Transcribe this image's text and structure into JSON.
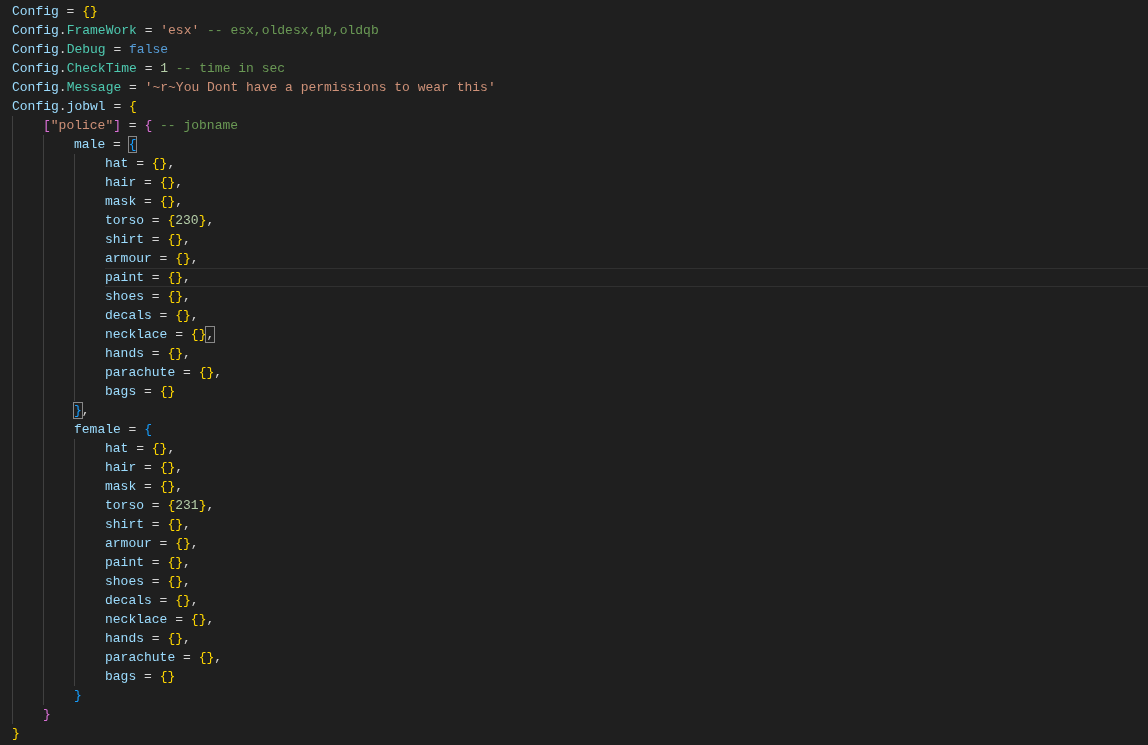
{
  "lines": [
    {
      "tokens": [
        {
          "text": "Config",
          "kind": "var"
        },
        {
          "text": " = ",
          "kind": "op"
        },
        {
          "text": "{}",
          "kind": "brace1"
        }
      ]
    },
    {
      "tokens": [
        {
          "text": "Config",
          "kind": "var"
        },
        {
          "text": ".",
          "kind": "op"
        },
        {
          "text": "FrameWork",
          "kind": "prop"
        },
        {
          "text": " = ",
          "kind": "op"
        },
        {
          "text": "'esx'",
          "kind": "string"
        },
        {
          "text": " -- esx,oldesx,qb,oldqb",
          "kind": "comment"
        }
      ]
    },
    {
      "tokens": [
        {
          "text": "Config",
          "kind": "var"
        },
        {
          "text": ".",
          "kind": "op"
        },
        {
          "text": "Debug",
          "kind": "prop"
        },
        {
          "text": " = ",
          "kind": "op"
        },
        {
          "text": "false",
          "kind": "keyword"
        }
      ]
    },
    {
      "tokens": [
        {
          "text": "Config",
          "kind": "var"
        },
        {
          "text": ".",
          "kind": "op"
        },
        {
          "text": "CheckTime",
          "kind": "prop"
        },
        {
          "text": " = ",
          "kind": "op"
        },
        {
          "text": "1",
          "kind": "number"
        },
        {
          "text": " -- time in sec",
          "kind": "comment"
        }
      ]
    },
    {
      "tokens": [
        {
          "text": "Config",
          "kind": "var"
        },
        {
          "text": ".",
          "kind": "op"
        },
        {
          "text": "Message",
          "kind": "prop"
        },
        {
          "text": " = ",
          "kind": "op"
        },
        {
          "text": "'~r~You Dont have a permissions to wear this'",
          "kind": "string"
        }
      ]
    },
    {
      "tokens": [
        {
          "text": "Config",
          "kind": "var"
        },
        {
          "text": ".",
          "kind": "op"
        },
        {
          "text": "jobwl",
          "kind": "var"
        },
        {
          "text": " = ",
          "kind": "op"
        },
        {
          "text": "{",
          "kind": "brace1"
        }
      ],
      "children": [
        {
          "tokens": [
            {
              "text": "[",
              "kind": "brace2"
            },
            {
              "text": "\"police\"",
              "kind": "string"
            },
            {
              "text": "]",
              "kind": "brace2"
            },
            {
              "text": " = ",
              "kind": "op"
            },
            {
              "text": "{",
              "kind": "brace2"
            },
            {
              "text": " -- jobname",
              "kind": "comment"
            }
          ],
          "children": [
            {
              "tokens": [
                {
                  "text": "male",
                  "kind": "var"
                },
                {
                  "text": " = ",
                  "kind": "op"
                },
                {
                  "text": "{",
                  "kind": "brace3",
                  "boxed": true
                }
              ],
              "children": [
                {
                  "tokens": [
                    {
                      "text": "hat",
                      "kind": "var"
                    },
                    {
                      "text": " = ",
                      "kind": "op"
                    },
                    {
                      "text": "{}",
                      "kind": "brace1"
                    },
                    {
                      "text": ",",
                      "kind": "op"
                    }
                  ]
                },
                {
                  "tokens": [
                    {
                      "text": "hair",
                      "kind": "var"
                    },
                    {
                      "text": " = ",
                      "kind": "op"
                    },
                    {
                      "text": "{}",
                      "kind": "brace1"
                    },
                    {
                      "text": ",",
                      "kind": "op"
                    }
                  ]
                },
                {
                  "tokens": [
                    {
                      "text": "mask",
                      "kind": "var"
                    },
                    {
                      "text": " = ",
                      "kind": "op"
                    },
                    {
                      "text": "{}",
                      "kind": "brace1"
                    },
                    {
                      "text": ",",
                      "kind": "op"
                    }
                  ]
                },
                {
                  "tokens": [
                    {
                      "text": "torso",
                      "kind": "var"
                    },
                    {
                      "text": " = ",
                      "kind": "op"
                    },
                    {
                      "text": "{",
                      "kind": "brace1"
                    },
                    {
                      "text": "230",
                      "kind": "number"
                    },
                    {
                      "text": "}",
                      "kind": "brace1"
                    },
                    {
                      "text": ",",
                      "kind": "op"
                    }
                  ]
                },
                {
                  "tokens": [
                    {
                      "text": "shirt",
                      "kind": "var"
                    },
                    {
                      "text": " = ",
                      "kind": "op"
                    },
                    {
                      "text": "{}",
                      "kind": "brace1"
                    },
                    {
                      "text": ",",
                      "kind": "op"
                    }
                  ]
                },
                {
                  "tokens": [
                    {
                      "text": "armour",
                      "kind": "var"
                    },
                    {
                      "text": " = ",
                      "kind": "op"
                    },
                    {
                      "text": "{}",
                      "kind": "brace1"
                    },
                    {
                      "text": ",",
                      "kind": "op"
                    }
                  ]
                },
                {
                  "tokens": [
                    {
                      "text": "paint",
                      "kind": "var"
                    },
                    {
                      "text": " = ",
                      "kind": "op"
                    },
                    {
                      "text": "{}",
                      "kind": "brace1"
                    },
                    {
                      "text": ",",
                      "kind": "op"
                    }
                  ],
                  "current": true
                },
                {
                  "tokens": [
                    {
                      "text": "shoes",
                      "kind": "var"
                    },
                    {
                      "text": " = ",
                      "kind": "op"
                    },
                    {
                      "text": "{}",
                      "kind": "brace1"
                    },
                    {
                      "text": ",",
                      "kind": "op"
                    }
                  ]
                },
                {
                  "tokens": [
                    {
                      "text": "decals",
                      "kind": "var"
                    },
                    {
                      "text": " = ",
                      "kind": "op"
                    },
                    {
                      "text": "{}",
                      "kind": "brace1"
                    },
                    {
                      "text": ",",
                      "kind": "op"
                    }
                  ]
                },
                {
                  "tokens": [
                    {
                      "text": "necklace",
                      "kind": "var"
                    },
                    {
                      "text": " = ",
                      "kind": "op"
                    },
                    {
                      "text": "{}",
                      "kind": "brace1"
                    },
                    {
                      "text": ",",
                      "kind": "op",
                      "boxed": true
                    }
                  ]
                },
                {
                  "tokens": [
                    {
                      "text": "hands",
                      "kind": "var"
                    },
                    {
                      "text": " = ",
                      "kind": "op"
                    },
                    {
                      "text": "{}",
                      "kind": "brace1"
                    },
                    {
                      "text": ",",
                      "kind": "op"
                    }
                  ]
                },
                {
                  "tokens": [
                    {
                      "text": "parachute",
                      "kind": "var"
                    },
                    {
                      "text": " = ",
                      "kind": "op"
                    },
                    {
                      "text": "{}",
                      "kind": "brace1"
                    },
                    {
                      "text": ",",
                      "kind": "op"
                    }
                  ]
                },
                {
                  "tokens": [
                    {
                      "text": "bags",
                      "kind": "var"
                    },
                    {
                      "text": " = ",
                      "kind": "op"
                    },
                    {
                      "text": "{}",
                      "kind": "brace1"
                    }
                  ]
                }
              ]
            },
            {
              "tokens": [
                {
                  "text": "}",
                  "kind": "brace3",
                  "boxed": true
                },
                {
                  "text": ",",
                  "kind": "op"
                }
              ]
            },
            {
              "tokens": [
                {
                  "text": "female",
                  "kind": "var"
                },
                {
                  "text": " = ",
                  "kind": "op"
                },
                {
                  "text": "{",
                  "kind": "brace3"
                }
              ],
              "children": [
                {
                  "tokens": [
                    {
                      "text": "hat",
                      "kind": "var"
                    },
                    {
                      "text": " = ",
                      "kind": "op"
                    },
                    {
                      "text": "{}",
                      "kind": "brace1"
                    },
                    {
                      "text": ",",
                      "kind": "op"
                    }
                  ]
                },
                {
                  "tokens": [
                    {
                      "text": "hair",
                      "kind": "var"
                    },
                    {
                      "text": " = ",
                      "kind": "op"
                    },
                    {
                      "text": "{}",
                      "kind": "brace1"
                    },
                    {
                      "text": ",",
                      "kind": "op"
                    }
                  ]
                },
                {
                  "tokens": [
                    {
                      "text": "mask",
                      "kind": "var"
                    },
                    {
                      "text": " = ",
                      "kind": "op"
                    },
                    {
                      "text": "{}",
                      "kind": "brace1"
                    },
                    {
                      "text": ",",
                      "kind": "op"
                    }
                  ]
                },
                {
                  "tokens": [
                    {
                      "text": "torso",
                      "kind": "var"
                    },
                    {
                      "text": " = ",
                      "kind": "op"
                    },
                    {
                      "text": "{",
                      "kind": "brace1"
                    },
                    {
                      "text": "231",
                      "kind": "number"
                    },
                    {
                      "text": "}",
                      "kind": "brace1"
                    },
                    {
                      "text": ",",
                      "kind": "op"
                    }
                  ]
                },
                {
                  "tokens": [
                    {
                      "text": "shirt",
                      "kind": "var"
                    },
                    {
                      "text": " = ",
                      "kind": "op"
                    },
                    {
                      "text": "{}",
                      "kind": "brace1"
                    },
                    {
                      "text": ",",
                      "kind": "op"
                    }
                  ]
                },
                {
                  "tokens": [
                    {
                      "text": "armour",
                      "kind": "var"
                    },
                    {
                      "text": " = ",
                      "kind": "op"
                    },
                    {
                      "text": "{}",
                      "kind": "brace1"
                    },
                    {
                      "text": ",",
                      "kind": "op"
                    }
                  ]
                },
                {
                  "tokens": [
                    {
                      "text": "paint",
                      "kind": "var"
                    },
                    {
                      "text": " = ",
                      "kind": "op"
                    },
                    {
                      "text": "{}",
                      "kind": "brace1"
                    },
                    {
                      "text": ",",
                      "kind": "op"
                    }
                  ]
                },
                {
                  "tokens": [
                    {
                      "text": "shoes",
                      "kind": "var"
                    },
                    {
                      "text": " = ",
                      "kind": "op"
                    },
                    {
                      "text": "{}",
                      "kind": "brace1"
                    },
                    {
                      "text": ",",
                      "kind": "op"
                    }
                  ]
                },
                {
                  "tokens": [
                    {
                      "text": "decals",
                      "kind": "var"
                    },
                    {
                      "text": " = ",
                      "kind": "op"
                    },
                    {
                      "text": "{}",
                      "kind": "brace1"
                    },
                    {
                      "text": ",",
                      "kind": "op"
                    }
                  ]
                },
                {
                  "tokens": [
                    {
                      "text": "necklace",
                      "kind": "var"
                    },
                    {
                      "text": " = ",
                      "kind": "op"
                    },
                    {
                      "text": "{}",
                      "kind": "brace1"
                    },
                    {
                      "text": ",",
                      "kind": "op"
                    }
                  ]
                },
                {
                  "tokens": [
                    {
                      "text": "hands",
                      "kind": "var"
                    },
                    {
                      "text": " = ",
                      "kind": "op"
                    },
                    {
                      "text": "{}",
                      "kind": "brace1"
                    },
                    {
                      "text": ",",
                      "kind": "op"
                    }
                  ]
                },
                {
                  "tokens": [
                    {
                      "text": "parachute",
                      "kind": "var"
                    },
                    {
                      "text": " = ",
                      "kind": "op"
                    },
                    {
                      "text": "{}",
                      "kind": "brace1"
                    },
                    {
                      "text": ",",
                      "kind": "op"
                    }
                  ]
                },
                {
                  "tokens": [
                    {
                      "text": "bags",
                      "kind": "var"
                    },
                    {
                      "text": " = ",
                      "kind": "op"
                    },
                    {
                      "text": "{}",
                      "kind": "brace1"
                    }
                  ]
                }
              ]
            },
            {
              "tokens": [
                {
                  "text": "}",
                  "kind": "brace3"
                }
              ]
            }
          ]
        },
        {
          "tokens": [
            {
              "text": "}",
              "kind": "brace2"
            }
          ]
        }
      ]
    },
    {
      "tokens": [
        {
          "text": "}",
          "kind": "brace1"
        }
      ]
    }
  ]
}
